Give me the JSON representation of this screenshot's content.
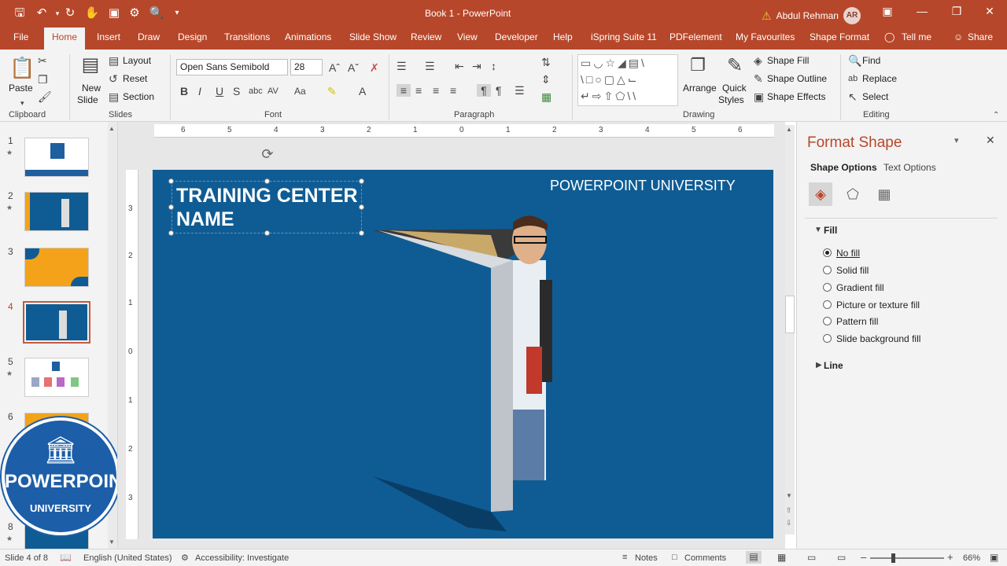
{
  "app": {
    "title": "Book 1 - PowerPoint",
    "user_name": "Abdul Rehman",
    "user_initials": "AR"
  },
  "quick_access": [
    "save-icon",
    "undo-icon",
    "redo-icon",
    "touch-mode-icon",
    "record-icon",
    "preview-icon",
    "customize-icon"
  ],
  "tabs": [
    "File",
    "Home",
    "Insert",
    "Draw",
    "Design",
    "Transitions",
    "Animations",
    "Slide Show",
    "Review",
    "View",
    "Developer",
    "Help",
    "iSpring Suite 11",
    "PDFelement",
    "My Favourites",
    "Shape Format",
    "Tell me",
    "Share"
  ],
  "ribbon": {
    "clipboard": {
      "paste": "Paste",
      "label": "Clipboard"
    },
    "slides": {
      "new_slide_1": "New",
      "new_slide_2": "Slide",
      "layout": "Layout",
      "reset": "Reset",
      "section": "Section",
      "label": "Slides"
    },
    "font": {
      "name": "Open Sans Semibold",
      "size": "28",
      "label": "Font"
    },
    "paragraph": {
      "label": "Paragraph"
    },
    "drawing": {
      "arrange": "Arrange",
      "quick_styles_1": "Quick",
      "quick_styles_2": "Styles",
      "shape_fill": "Shape Fill",
      "shape_outline": "Shape Outline",
      "shape_effects": "Shape Effects",
      "label": "Drawing"
    },
    "editing": {
      "find": "Find",
      "replace": "Replace",
      "select": "Select",
      "label": "Editing"
    }
  },
  "ruler": {
    "horizontal": [
      "6",
      "5",
      "4",
      "3",
      "2",
      "1",
      "0",
      "1",
      "2",
      "3",
      "4",
      "5",
      "6"
    ],
    "vertical": [
      "3",
      "2",
      "1",
      "0",
      "1",
      "2",
      "3"
    ]
  },
  "slides": [
    {
      "num": "1",
      "starred": true
    },
    {
      "num": "2",
      "starred": true
    },
    {
      "num": "3",
      "starred": false
    },
    {
      "num": "4",
      "starred": false,
      "active": true
    },
    {
      "num": "5",
      "starred": true
    },
    {
      "num": "6",
      "starred": false
    },
    {
      "num": "8",
      "starred": true
    }
  ],
  "watermark": {
    "top": "POWERPOINT",
    "bottom": "UNIVERSITY"
  },
  "slide_content": {
    "title_line1": "TRAINING CENTER",
    "title_line2": "NAME",
    "brand": "POWERPOINT UNIVERSITY"
  },
  "format_panel": {
    "title": "Format Shape",
    "tab_shape": "Shape Options",
    "tab_text": "Text Options",
    "fill_header": "Fill",
    "fill_options": [
      "No fill",
      "Solid fill",
      "Gradient fill",
      "Picture or texture fill",
      "Pattern fill",
      "Slide background fill"
    ],
    "selected_fill": "No fill",
    "line_header": "Line"
  },
  "status": {
    "slide": "Slide 4 of 8",
    "language": "English (United States)",
    "accessibility": "Accessibility: Investigate",
    "notes": "Notes",
    "comments": "Comments",
    "zoom": "66%"
  },
  "colors": {
    "accent": "#b7472a",
    "slide_bg": "#0f5c94"
  }
}
